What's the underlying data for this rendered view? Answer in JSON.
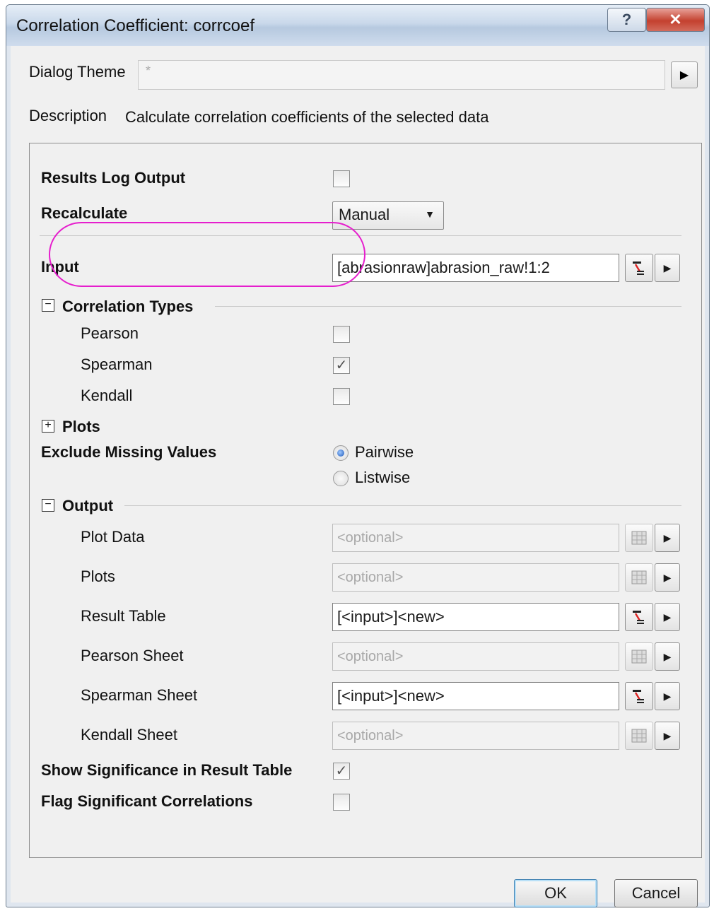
{
  "window": {
    "title": "Correlation Coefficient: corrcoef",
    "help_glyph": "?",
    "close_glyph": "✕"
  },
  "dialog_theme": {
    "label": "Dialog Theme",
    "value": "*"
  },
  "description": {
    "label": "Description",
    "text": "Calculate correlation coefficients of the selected data"
  },
  "settings": {
    "results_log_output": {
      "label": "Results Log Output",
      "checked": false
    },
    "recalculate": {
      "label": "Recalculate",
      "value": "Manual"
    },
    "input": {
      "label": "Input",
      "value": "[abrasionraw]abrasion_raw!1:2"
    },
    "correlation_types": {
      "label": "Correlation Types",
      "expander": "−",
      "items": [
        {
          "label": "Pearson",
          "checked": false
        },
        {
          "label": "Spearman",
          "checked": true
        },
        {
          "label": "Kendall",
          "checked": false
        }
      ]
    },
    "plots": {
      "label": "Plots",
      "expander": "+"
    },
    "exclude_missing": {
      "label": "Exclude Missing Values",
      "options": [
        "Pairwise",
        "Listwise"
      ],
      "selected": "Pairwise"
    },
    "output": {
      "label": "Output",
      "expander": "−",
      "rows": [
        {
          "label": "Plot Data",
          "value": "<optional>",
          "enabled": false
        },
        {
          "label": "Plots",
          "value": "<optional>",
          "enabled": false
        },
        {
          "label": "Result Table",
          "value": "[<input>]<new>",
          "enabled": true
        },
        {
          "label": "Pearson Sheet",
          "value": "<optional>",
          "enabled": false
        },
        {
          "label": "Spearman Sheet",
          "value": "[<input>]<new>",
          "enabled": true
        },
        {
          "label": "Kendall Sheet",
          "value": "<optional>",
          "enabled": false
        }
      ]
    },
    "show_significance": {
      "label": "Show Significance in Result Table",
      "checked": true
    },
    "flag_significant": {
      "label": "Flag Significant Correlations",
      "checked": false
    }
  },
  "buttons": {
    "ok": "OK",
    "cancel": "Cancel"
  },
  "colors": {
    "highlight": "#e61ecd",
    "ok_border": "#3c7fb1"
  }
}
